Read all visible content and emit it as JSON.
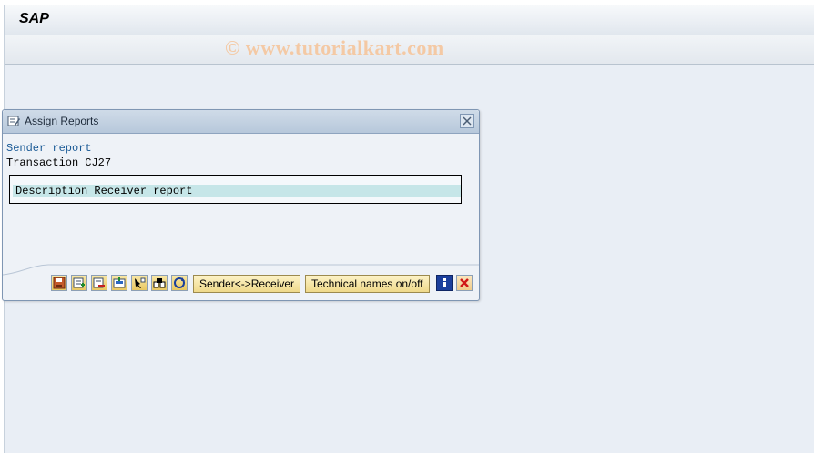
{
  "app": {
    "title": "SAP",
    "watermark": "© www.tutorialkart.com"
  },
  "dialog": {
    "title": "Assign Reports",
    "sender_label": "Sender report",
    "transaction_label": "Transaction",
    "transaction_value": "CJ27",
    "description_row": "Description Receiver report"
  },
  "buttons": {
    "sender_receiver": "Sender<->Receiver",
    "technical_names": "Technical names on/off",
    "icons": [
      "save-icon",
      "new-entry-icon",
      "delete-row-icon",
      "insert-row-icon",
      "select-icon",
      "find-icon",
      "refresh-icon",
      "info-icon",
      "cancel-icon"
    ]
  }
}
